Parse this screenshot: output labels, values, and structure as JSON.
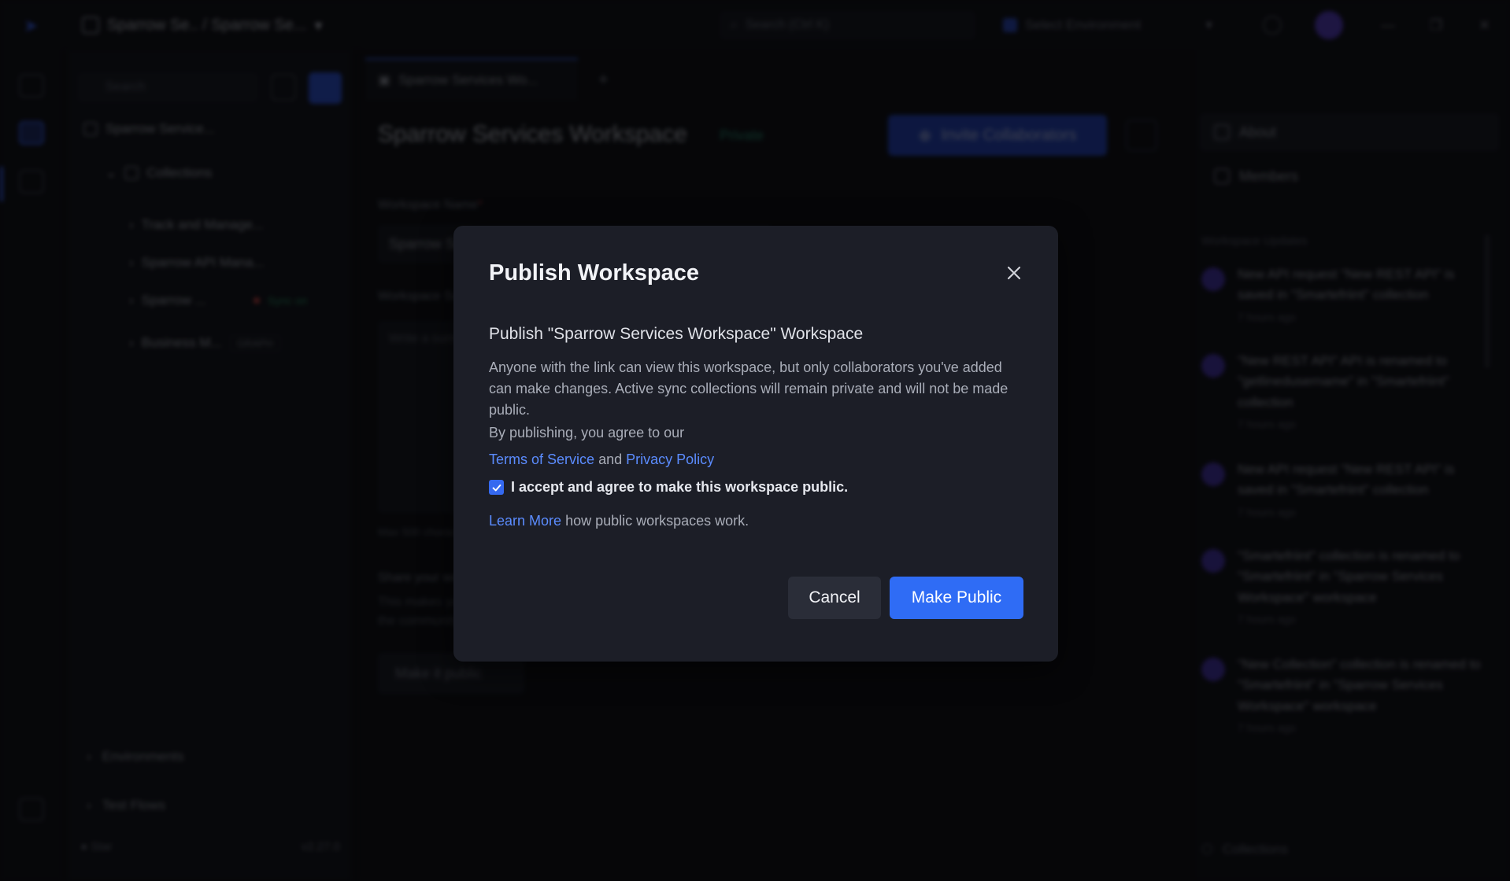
{
  "topbar": {
    "workspace_path": "Sparrow Se.. / Sparrow Se...",
    "search_placeholder": "Search (Ctrl K)",
    "shortcut": "Ctrl K",
    "environment": "Select Environment"
  },
  "sidebar": {
    "search_placeholder": "Search",
    "workspace_item": "Sparrow Service...",
    "collections_label": "Collections",
    "items": [
      {
        "label": "Track and Manage..."
      },
      {
        "label": "Sparrow API Mana..."
      },
      {
        "label": "Sparrow ...",
        "status": "Sync on"
      },
      {
        "label": "Business M...",
        "tag": "GRAPH"
      }
    ],
    "environments_label": "Environments",
    "testflows_label": "Test Flows",
    "github_label": "Star",
    "version": "v2.27.0"
  },
  "main": {
    "tab_label": "Sparrow Services Wo...",
    "title": "Sparrow Services Workspace",
    "privacy": "Private",
    "invite_label": "Invite Collaborators",
    "name_label": "Workspace Name",
    "name_value": "Sparrow Services Workspace",
    "summary_label": "Workspace Summary",
    "summary_placeholder": "Write a summary...",
    "hint": "Max 500 characters",
    "share_heading": "Share your workspace",
    "share_desc": "This makes your workspace visible to everyone and be connected with the community.",
    "make_public_bg": "Make it public"
  },
  "rightpanel": {
    "about_tab": "About",
    "members_tab": "Members",
    "section": "Workspace Updates",
    "feed": [
      {
        "text": "New API request \"New REST API\" is saved in \"Smartefriint\" collection",
        "time": "7 hours ago"
      },
      {
        "text": "\"New REST API\" API is renamed to \"getlinedusername\" in \"Smartefriint\" collection",
        "time": "7 hours ago"
      },
      {
        "text": "New API request \"New REST API\" is saved in \"Smartefriint\" collection",
        "time": "7 hours ago"
      },
      {
        "text": "\"Smartefriint\" collection is renamed to \"Smartefriint\" in \"Sparrow Services Workspace\" workspace",
        "time": "7 hours ago"
      },
      {
        "text": "\"New Collection\" collection is renamed to \"Smartefriint\" in \"Sparrow Services Workspace\" workspace",
        "time": "7 hours ago"
      }
    ],
    "bottom_label": "Collections"
  },
  "modal": {
    "title": "Publish Workspace",
    "subtitle": "Publish \"Sparrow Services Workspace\" Workspace",
    "body": "Anyone with the link can view this workspace, but only collaborators you've added can make changes. Active sync collections will remain private and will not be made public.",
    "agree_text": "By publishing, you agree to our",
    "terms_link": "Terms of Service",
    "and_text": "and",
    "privacy_link": "Privacy Policy",
    "accept_label": "I accept and agree to make this workspace public.",
    "learn_more_link": "Learn More",
    "learn_more_suffix": "how public workspaces work.",
    "cancel_label": "Cancel",
    "confirm_label": "Make Public",
    "accept_checked": true
  },
  "colors": {
    "accent": "#2f6cf5",
    "link": "#5b8cff",
    "modal_bg": "#1c1e27"
  }
}
